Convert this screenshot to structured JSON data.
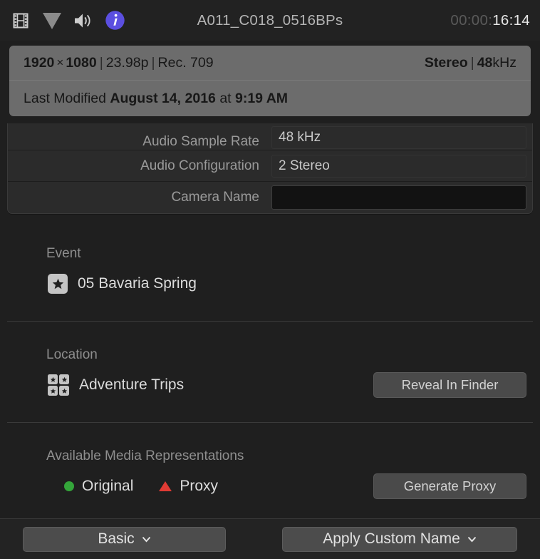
{
  "header": {
    "icons": [
      {
        "name": "film-strip-icon",
        "label": "video"
      },
      {
        "name": "triangle-down-icon",
        "label": "video-roles"
      },
      {
        "name": "speaker-icon",
        "label": "audio"
      },
      {
        "name": "info-icon",
        "label": "info"
      }
    ],
    "title": "A011_C018_0516BPs",
    "timecode_dim": "00:00:",
    "timecode_lit": "16:14",
    "info_icon_color": "#5b4fe0"
  },
  "banner": {
    "resolution_w": "1920",
    "times": "×",
    "resolution_h": "1080",
    "pipe": "|",
    "framerate": "23.98p",
    "colorspace": "Rec. 709",
    "audio_channels": "Stereo",
    "audio_rate_num": "48",
    "audio_rate_unit": "kHz",
    "modified_label": "Last Modified",
    "modified_date": "August 14, 2016",
    "modified_at": "at",
    "modified_time": "9:19 AM"
  },
  "metadata": {
    "rows": [
      {
        "label": "Audio Sample Rate",
        "value": "48 kHz",
        "editable": false
      },
      {
        "label": "Audio Configuration",
        "value": "2 Stereo",
        "editable": false
      },
      {
        "label": "Camera Name",
        "value": "",
        "editable": true
      }
    ]
  },
  "event": {
    "title": "Event",
    "name": "05 Bavaria Spring",
    "icon": "star-event-icon"
  },
  "location": {
    "title": "Location",
    "name": "Adventure Trips",
    "icon": "library-grid-icon",
    "button": "Reveal In Finder"
  },
  "media": {
    "title": "Available Media Representations",
    "items": [
      {
        "label": "Original",
        "marker": "green-circle-icon",
        "color": "#34a53a"
      },
      {
        "label": "Proxy",
        "marker": "red-triangle-icon",
        "color": "#e03b34"
      }
    ],
    "button": "Generate Proxy"
  },
  "footer": {
    "view_menu": "Basic",
    "apply_menu": "Apply Custom Name",
    "chevron": "⌄"
  }
}
